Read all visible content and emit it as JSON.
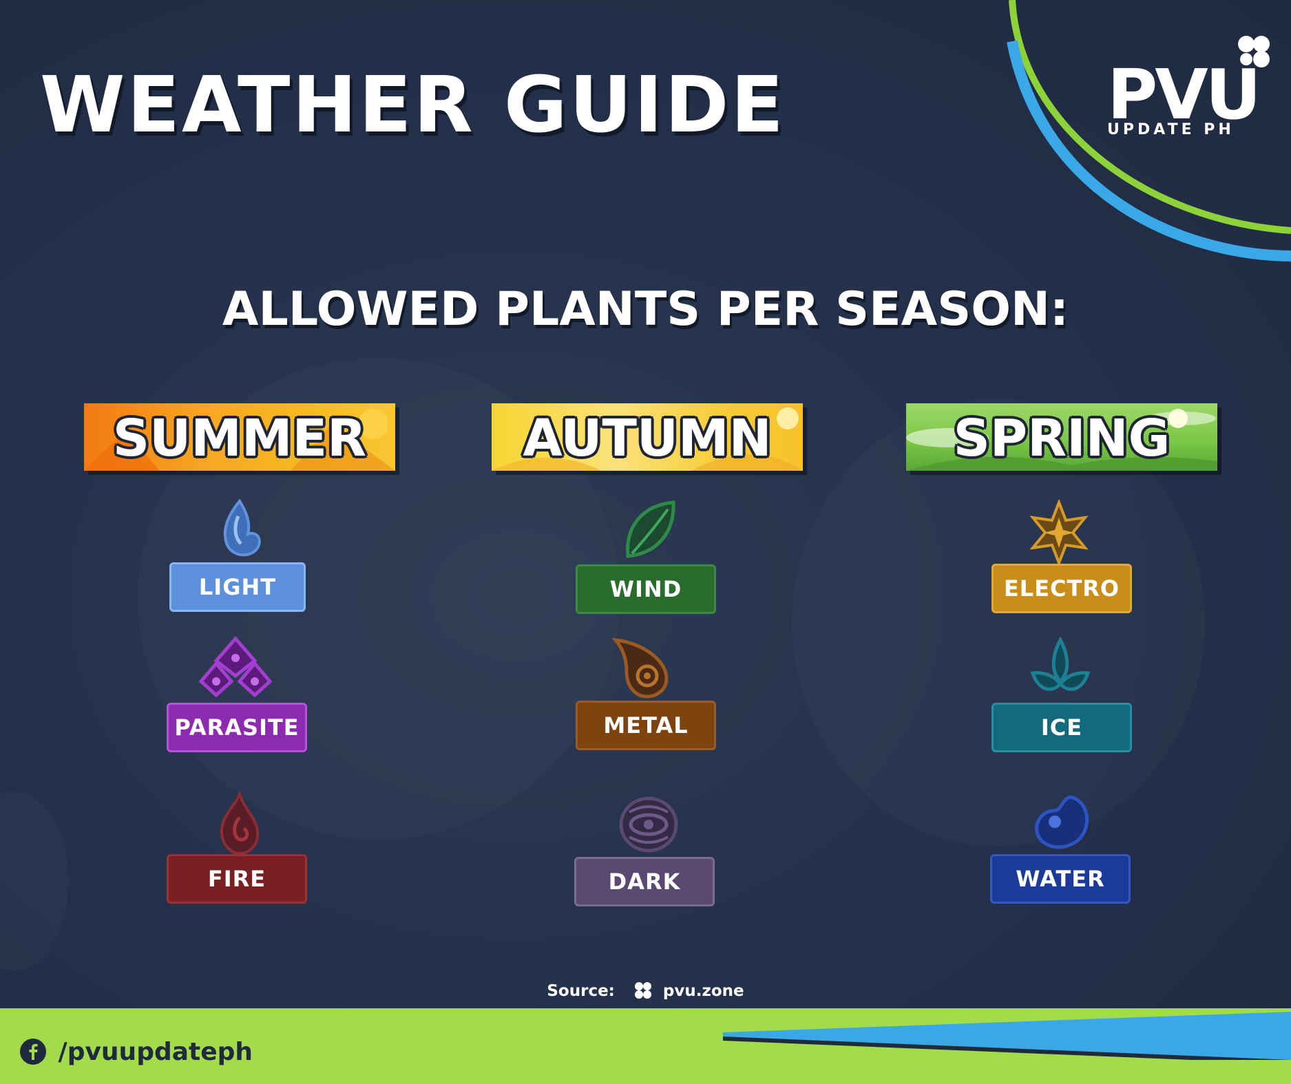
{
  "header": {
    "title": "WEATHER GUIDE",
    "logo_text": "PVU",
    "logo_subtitle": "UPDATE PH"
  },
  "main": {
    "heading": "ALLOWED PLANTS PER SEASON:"
  },
  "seasons": [
    {
      "name": "SUMMER",
      "banner_color": "#f7a322",
      "elements": [
        {
          "name": "LIGHT",
          "icon": "light-element-icon",
          "color": "#5c8fdc"
        },
        {
          "name": "PARASITE",
          "icon": "parasite-element-icon",
          "color": "#8c2ab0"
        },
        {
          "name": "FIRE",
          "icon": "fire-element-icon",
          "color": "#7a1f22"
        }
      ]
    },
    {
      "name": "AUTUMN",
      "banner_color": "#f7d530",
      "elements": [
        {
          "name": "WIND",
          "icon": "wind-element-icon",
          "color": "#2a6b2e"
        },
        {
          "name": "METAL",
          "icon": "metal-element-icon",
          "color": "#7d4410"
        },
        {
          "name": "DARK",
          "icon": "dark-element-icon",
          "color": "#5a4a72"
        }
      ]
    },
    {
      "name": "SPRING",
      "banner_color": "#7cc847",
      "elements": [
        {
          "name": "ELECTRO",
          "icon": "electro-element-icon",
          "color": "#c98e1a"
        },
        {
          "name": "ICE",
          "icon": "ice-element-icon",
          "color": "#136a7c"
        },
        {
          "name": "WATER",
          "icon": "water-element-icon",
          "color": "#1c3a9a"
        }
      ]
    }
  ],
  "footer": {
    "source_label": "Source:",
    "source_site": "pvu.zone",
    "social_handle": "/pvuupdateph"
  },
  "colors": {
    "background": "#25324a",
    "footer_green": "#a3dc4a",
    "accent_blue": "#3aa8e6"
  }
}
